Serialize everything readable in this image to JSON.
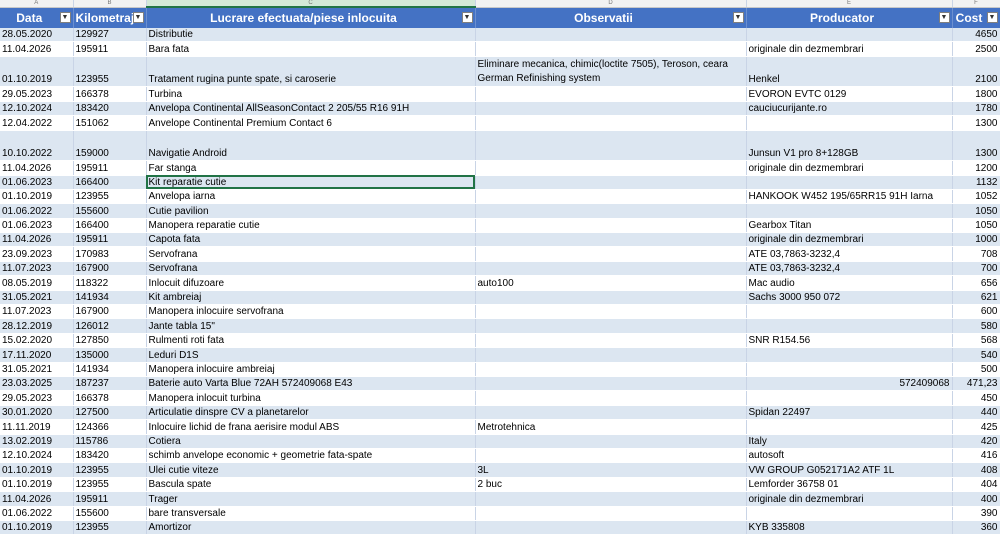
{
  "column_letters": [
    "A",
    "B",
    "C",
    "D",
    "E",
    "F"
  ],
  "headers": {
    "data": "Data",
    "km": "Kilometraj",
    "lucrare": "Lucrare efectuata/piese inlocuita",
    "obs": "Observatii",
    "prod": "Producator",
    "cost": "Cost"
  },
  "rows": [
    {
      "data": "28.05.2020",
      "km": "129927",
      "lucrare": "Distributie",
      "obs": "",
      "prod": "",
      "cost": "4650"
    },
    {
      "data": "11.04.2026",
      "km": "195911",
      "lucrare": "Bara fata",
      "obs": "",
      "prod": "originale din dezmembrari",
      "cost": "2500"
    },
    {
      "data": "01.10.2019",
      "km": "123955",
      "lucrare": "Tratament rugina punte spate, si caroserie",
      "obs": "Eliminare mecanica, chimic(loctite 7505), Teroson, ceara German Refinishing system",
      "prod": "Henkel",
      "cost": "2100",
      "tall": true
    },
    {
      "data": "29.05.2023",
      "km": "166378",
      "lucrare": "Turbina",
      "obs": "",
      "prod": "EVORON EVTC 0129",
      "cost": "1800"
    },
    {
      "data": "12.10.2024",
      "km": "183420",
      "lucrare": "Anvelopa Continental AllSeasonContact 2 205/55 R16 91H",
      "obs": "",
      "prod": "cauciucurijante.ro",
      "cost": "1780"
    },
    {
      "data": "12.04.2022",
      "km": "151062",
      "lucrare": "Anvelope Continental Premium Contact 6",
      "obs": "",
      "prod": "",
      "cost": "1300"
    },
    {
      "data": "10.10.2022",
      "km": "159000",
      "lucrare": "Navigatie Android",
      "obs": "",
      "prod": "Junsun V1 pro 8+128GB",
      "cost": "1300",
      "tall": true
    },
    {
      "data": "11.04.2026",
      "km": "195911",
      "lucrare": "Far stanga",
      "obs": "",
      "prod": "originale din dezmembrari",
      "cost": "1200"
    },
    {
      "data": "01.06.2023",
      "km": "166400",
      "lucrare": "Kit reparatie cutie",
      "obs": "",
      "prod": "",
      "cost": "1132",
      "active": true
    },
    {
      "data": "01.10.2019",
      "km": "123955",
      "lucrare": "Anvelopa iarna",
      "obs": "",
      "prod": "HANKOOK W452 195/65RR15 91H Iarna",
      "cost": "1052"
    },
    {
      "data": "01.06.2022",
      "km": "155600",
      "lucrare": "Cutie pavilion",
      "obs": "",
      "prod": "",
      "cost": "1050"
    },
    {
      "data": "01.06.2023",
      "km": "166400",
      "lucrare": "Manopera reparatie cutie",
      "obs": "",
      "prod": "Gearbox Titan",
      "cost": "1050"
    },
    {
      "data": "11.04.2026",
      "km": "195911",
      "lucrare": "Capota fata",
      "obs": "",
      "prod": "originale din dezmembrari",
      "cost": "1000"
    },
    {
      "data": "23.09.2023",
      "km": "170983",
      "lucrare": "Servofrana",
      "obs": "",
      "prod": "ATE 03,7863-3232,4",
      "cost": "708"
    },
    {
      "data": "11.07.2023",
      "km": "167900",
      "lucrare": "Servofrana",
      "obs": "",
      "prod": "ATE 03,7863-3232,4",
      "cost": "700"
    },
    {
      "data": "08.05.2019",
      "km": "118322",
      "lucrare": "Inlocuit difuzoare",
      "obs": "auto100",
      "prod": "Mac audio",
      "cost": "656"
    },
    {
      "data": "31.05.2021",
      "km": "141934",
      "lucrare": "Kit ambreiaj",
      "obs": "",
      "prod": "Sachs 3000 950 072",
      "cost": "621"
    },
    {
      "data": "11.07.2023",
      "km": "167900",
      "lucrare": "Manopera inlocuire servofrana",
      "obs": "",
      "prod": "",
      "cost": "600"
    },
    {
      "data": "28.12.2019",
      "km": "126012",
      "lucrare": "Jante tabla 15\"",
      "obs": "",
      "prod": "",
      "cost": "580"
    },
    {
      "data": "15.02.2020",
      "km": "127850",
      "lucrare": "Rulmenti roti fata",
      "obs": "",
      "prod": "SNR R154.56",
      "cost": "568"
    },
    {
      "data": "17.11.2020",
      "km": "135000",
      "lucrare": "Leduri D1S",
      "obs": "",
      "prod": "",
      "cost": "540"
    },
    {
      "data": "31.05.2021",
      "km": "141934",
      "lucrare": "Manopera inlocuire ambreiaj",
      "obs": "",
      "prod": "",
      "cost": "500"
    },
    {
      "data": "23.03.2025",
      "km": "187237",
      "lucrare": "Baterie auto Varta Blue 72AH 572409068 E43",
      "obs": "",
      "prod": "572409068",
      "prod_right": true,
      "cost": "471,23"
    },
    {
      "data": "29.05.2023",
      "km": "166378",
      "lucrare": "Manopera inlocuit turbina",
      "obs": "",
      "prod": "",
      "cost": "450"
    },
    {
      "data": "30.01.2020",
      "km": "127500",
      "lucrare": "Articulatie dinspre CV a planetarelor",
      "obs": "",
      "prod": "Spidan 22497",
      "cost": "440"
    },
    {
      "data": "11.11.2019",
      "km": "124366",
      "lucrare": "Inlocuire lichid de frana aerisire modul ABS",
      "obs": "Metrotehnica",
      "prod": "",
      "cost": "425"
    },
    {
      "data": "13.02.2019",
      "km": "115786",
      "lucrare": "Cotiera",
      "obs": "",
      "prod": "Italy",
      "cost": "420"
    },
    {
      "data": "12.10.2024",
      "km": "183420",
      "lucrare": "schimb anvelope economic + geometrie fata-spate",
      "obs": "",
      "prod": "autosoft",
      "cost": "416"
    },
    {
      "data": "01.10.2019",
      "km": "123955",
      "lucrare": "Ulei cutie viteze",
      "obs": "3L",
      "prod": "VW GROUP G052171A2 ATF 1L",
      "cost": "408"
    },
    {
      "data": "01.10.2019",
      "km": "123955",
      "lucrare": "Bascula spate",
      "obs": "2 buc",
      "prod": " Lemforder 36758 01",
      "cost": "404"
    },
    {
      "data": "11.04.2026",
      "km": "195911",
      "lucrare": "Trager",
      "obs": "",
      "prod": "originale din dezmembrari",
      "cost": "400"
    },
    {
      "data": "01.06.2022",
      "km": "155600",
      "lucrare": "bare transversale",
      "obs": "",
      "prod": "",
      "cost": "390"
    },
    {
      "data": "01.10.2019",
      "km": "123955",
      "lucrare": "Amortizor",
      "obs": "",
      "prod": " KYB 335808",
      "cost": "360"
    }
  ],
  "icons": {
    "filter": "filter-dropdown-icon"
  },
  "colors": {
    "header_bg": "#4472c4",
    "band": "#dce6f1",
    "selection": "#217346"
  }
}
